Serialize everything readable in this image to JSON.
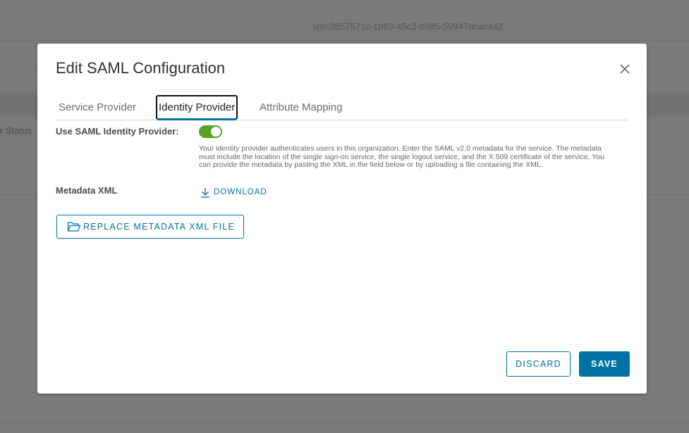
{
  "background": {
    "spn": "spn:0857571c-1b63-45c2-b985-59947dcaca42",
    "status_fragment": "r Status"
  },
  "modal": {
    "title": "Edit SAML Configuration",
    "tabs": [
      {
        "label": "Service Provider",
        "active": false
      },
      {
        "label": "Identity Provider",
        "active": true
      },
      {
        "label": "Attribute Mapping",
        "active": false
      }
    ],
    "use_idp_label": "Use SAML Identity Provider:",
    "use_idp_enabled": true,
    "help_text": "Your identity provider authenticates users in this organization. Enter the SAML v2.0 metadata for the service. The metadata must include the location of the single sign-on service, the single logout service, and the X.509 certificate of the service. You can provide the metadata by pasting the XML in the field below or by uploading a file containing the XML.",
    "metadata_label": "Metadata XML",
    "download_label": "DOWNLOAD",
    "replace_label": "REPLACE METADATA XML FILE",
    "discard_label": "DISCARD",
    "save_label": "SAVE"
  },
  "colors": {
    "accent": "#0072a3",
    "toggle_on": "#5aa220",
    "overlay": "#7a7a7a"
  },
  "icons": [
    "close-icon",
    "download-icon",
    "folder-open-icon"
  ]
}
